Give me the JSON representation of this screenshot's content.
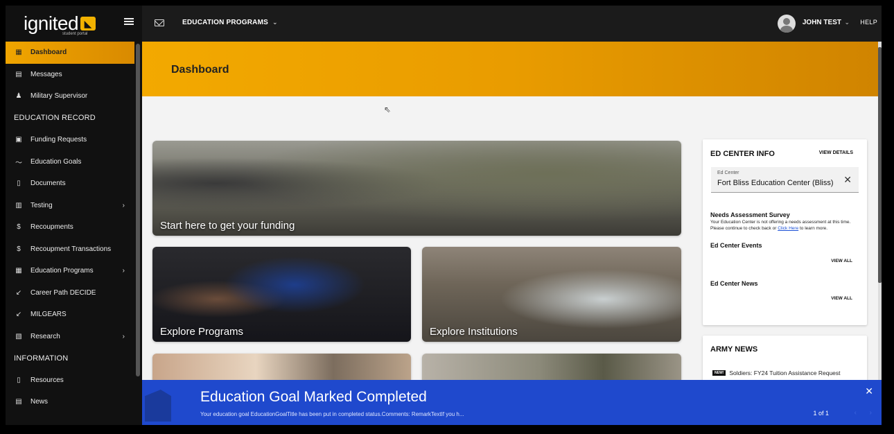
{
  "brand": {
    "name": "ignited",
    "tagline": "student portal"
  },
  "sidebar": {
    "items": [
      {
        "label": "Dashboard",
        "icon": "grid-icon"
      },
      {
        "label": "Messages",
        "icon": "message-icon"
      },
      {
        "label": "Military Supervisor",
        "icon": "people-icon"
      }
    ],
    "section_education": "EDUCATION RECORD",
    "education_items": [
      {
        "label": "Funding Requests",
        "icon": "funding-icon"
      },
      {
        "label": "Education Goals",
        "icon": "trend-icon"
      },
      {
        "label": "Documents",
        "icon": "document-icon"
      },
      {
        "label": "Testing",
        "icon": "testing-icon"
      },
      {
        "label": "Recoupments",
        "icon": "dollar-icon"
      },
      {
        "label": "Recoupment Transactions",
        "icon": "dollar-icon"
      },
      {
        "label": "Education Programs",
        "icon": "programs-icon"
      },
      {
        "label": "Career Path DECIDE",
        "icon": "arrow-icon"
      },
      {
        "label": "MILGEARS",
        "icon": "arrow-icon"
      },
      {
        "label": "Research",
        "icon": "research-icon"
      }
    ],
    "section_information": "INFORMATION",
    "info_items": [
      {
        "label": "Resources",
        "icon": "document-icon"
      },
      {
        "label": "News",
        "icon": "news-icon"
      }
    ]
  },
  "topbar": {
    "program": "EDUCATION PROGRAMS",
    "user": "JOHN TEST",
    "help": "HELP"
  },
  "page": {
    "title": "Dashboard"
  },
  "tiles": {
    "funding": "Start here to get your funding",
    "programs": "Explore Programs",
    "institutions": "Explore Institutions"
  },
  "ed_center": {
    "title": "ED CENTER INFO",
    "view_details": "VIEW DETAILS",
    "select_label": "Ed Center",
    "select_value": "Fort Bliss Education Center (Bliss)",
    "survey_title": "Needs Assessment Survey",
    "survey_text": "Your Education Center is not offering a needs assessment at this time. Please continue to check back or",
    "survey_link": "Click Here",
    "survey_text_end": "to learn more.",
    "events_title": "Ed Center Events",
    "events_view_all": "VIEW ALL",
    "news_title": "Ed Center News",
    "news_view_all": "VIEW ALL"
  },
  "army_news": {
    "title": "ARMY NEWS",
    "badge": "NEW!",
    "item": "Soldiers: FY24 Tuition Assistance Request"
  },
  "notification": {
    "title": "Education Goal Marked Completed",
    "message": "Your education goal EducationGoalTitle has been put in completed status.Comments: RemarkTextIf you h...",
    "count": "1 of 1"
  },
  "colors": {
    "accent": "#f0a500",
    "notification": "#1f49cd",
    "sidebar": "#111111"
  }
}
